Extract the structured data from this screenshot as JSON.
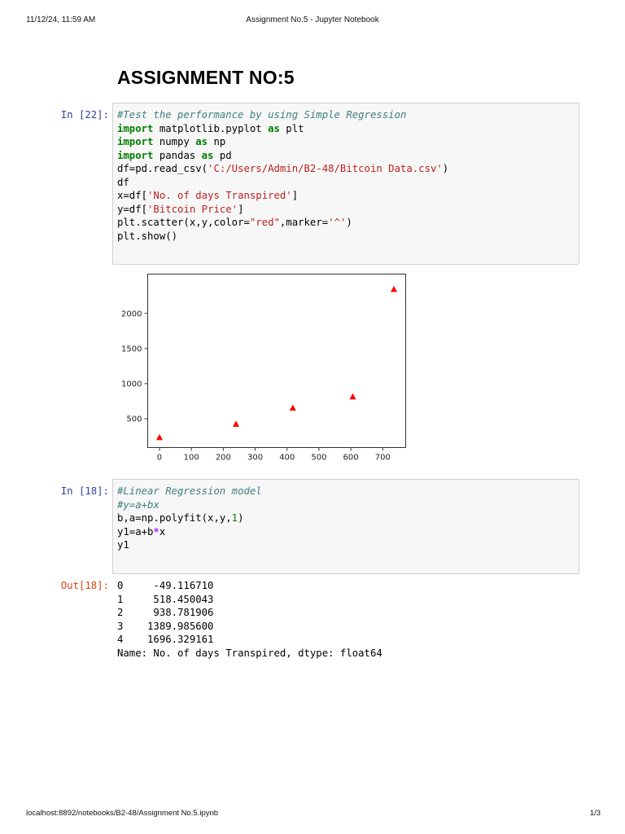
{
  "print_header": {
    "date": "11/12/24, 11:59 AM",
    "title": "Assignment No.5 - Jupyter Notebook"
  },
  "heading": "ASSIGNMENT NO:5",
  "cells": [
    {
      "prompt": "In [22]:",
      "lines": [
        [
          {
            "t": "#Test the performance by using Simple Regression",
            "c": "cm"
          }
        ],
        [
          {
            "t": "import",
            "c": "kw"
          },
          {
            "t": " matplotlib.pyplot "
          },
          {
            "t": "as",
            "c": "kw"
          },
          {
            "t": " plt"
          }
        ],
        [
          {
            "t": "import",
            "c": "kw"
          },
          {
            "t": " numpy "
          },
          {
            "t": "as",
            "c": "kw"
          },
          {
            "t": " np"
          }
        ],
        [
          {
            "t": "import",
            "c": "kw"
          },
          {
            "t": " pandas "
          },
          {
            "t": "as",
            "c": "kw"
          },
          {
            "t": " pd"
          }
        ],
        [
          {
            "t": "df=pd.read_csv("
          },
          {
            "t": "'C:/Users/Admin/B2-48/Bitcoin Data.csv'",
            "c": "str"
          },
          {
            "t": ")"
          }
        ],
        [
          {
            "t": "df"
          }
        ],
        [
          {
            "t": "x=df["
          },
          {
            "t": "'No. of days Transpired'",
            "c": "str"
          },
          {
            "t": "]"
          }
        ],
        [
          {
            "t": "y=df["
          },
          {
            "t": "'Bitcoin Price'",
            "c": "str"
          },
          {
            "t": "]"
          }
        ],
        [
          {
            "t": "plt.scatter(x,y,color="
          },
          {
            "t": "\"red\"",
            "c": "str"
          },
          {
            "t": ",marker="
          },
          {
            "t": "'^'",
            "c": "str"
          },
          {
            "t": ")"
          }
        ],
        [
          {
            "t": "plt.show()"
          }
        ]
      ]
    },
    {
      "prompt": "In [18]:",
      "lines": [
        [
          {
            "t": "#Linear Regression model",
            "c": "cm"
          }
        ],
        [
          {
            "t": "#y=a+bx",
            "c": "cm"
          }
        ],
        [
          {
            "t": "b,a=np.polyfit(x,y,"
          },
          {
            "t": "1",
            "c": "num"
          },
          {
            "t": ")"
          }
        ],
        [
          {
            "t": "y1=a+b"
          },
          {
            "t": "*",
            "c": "op"
          },
          {
            "t": "x"
          }
        ],
        [
          {
            "t": "y1"
          }
        ]
      ]
    }
  ],
  "output": {
    "prompt": "Out[18]:",
    "lines": [
      "0     -49.116710",
      "1     518.450043",
      "2     938.781906",
      "3    1389.985600",
      "4    1696.329161",
      "Name: No. of days Transpired, dtype: float64"
    ]
  },
  "chart_data": {
    "type": "scatter",
    "marker": "^",
    "marker_color": "#ff0000",
    "x": [
      0,
      240,
      418,
      606,
      735
    ],
    "y": [
      230,
      420,
      650,
      810,
      2340
    ],
    "xlim": [
      -37,
      772
    ],
    "ylim": [
      90,
      2560
    ],
    "xticks": [
      0,
      100,
      200,
      300,
      400,
      500,
      600,
      700
    ],
    "yticks": [
      500,
      1000,
      1500,
      2000
    ],
    "grid": false
  },
  "print_footer": {
    "url": "localhost:8892/notebooks/B2-48/Assignment No.5.ipynb",
    "page": "1/3"
  }
}
